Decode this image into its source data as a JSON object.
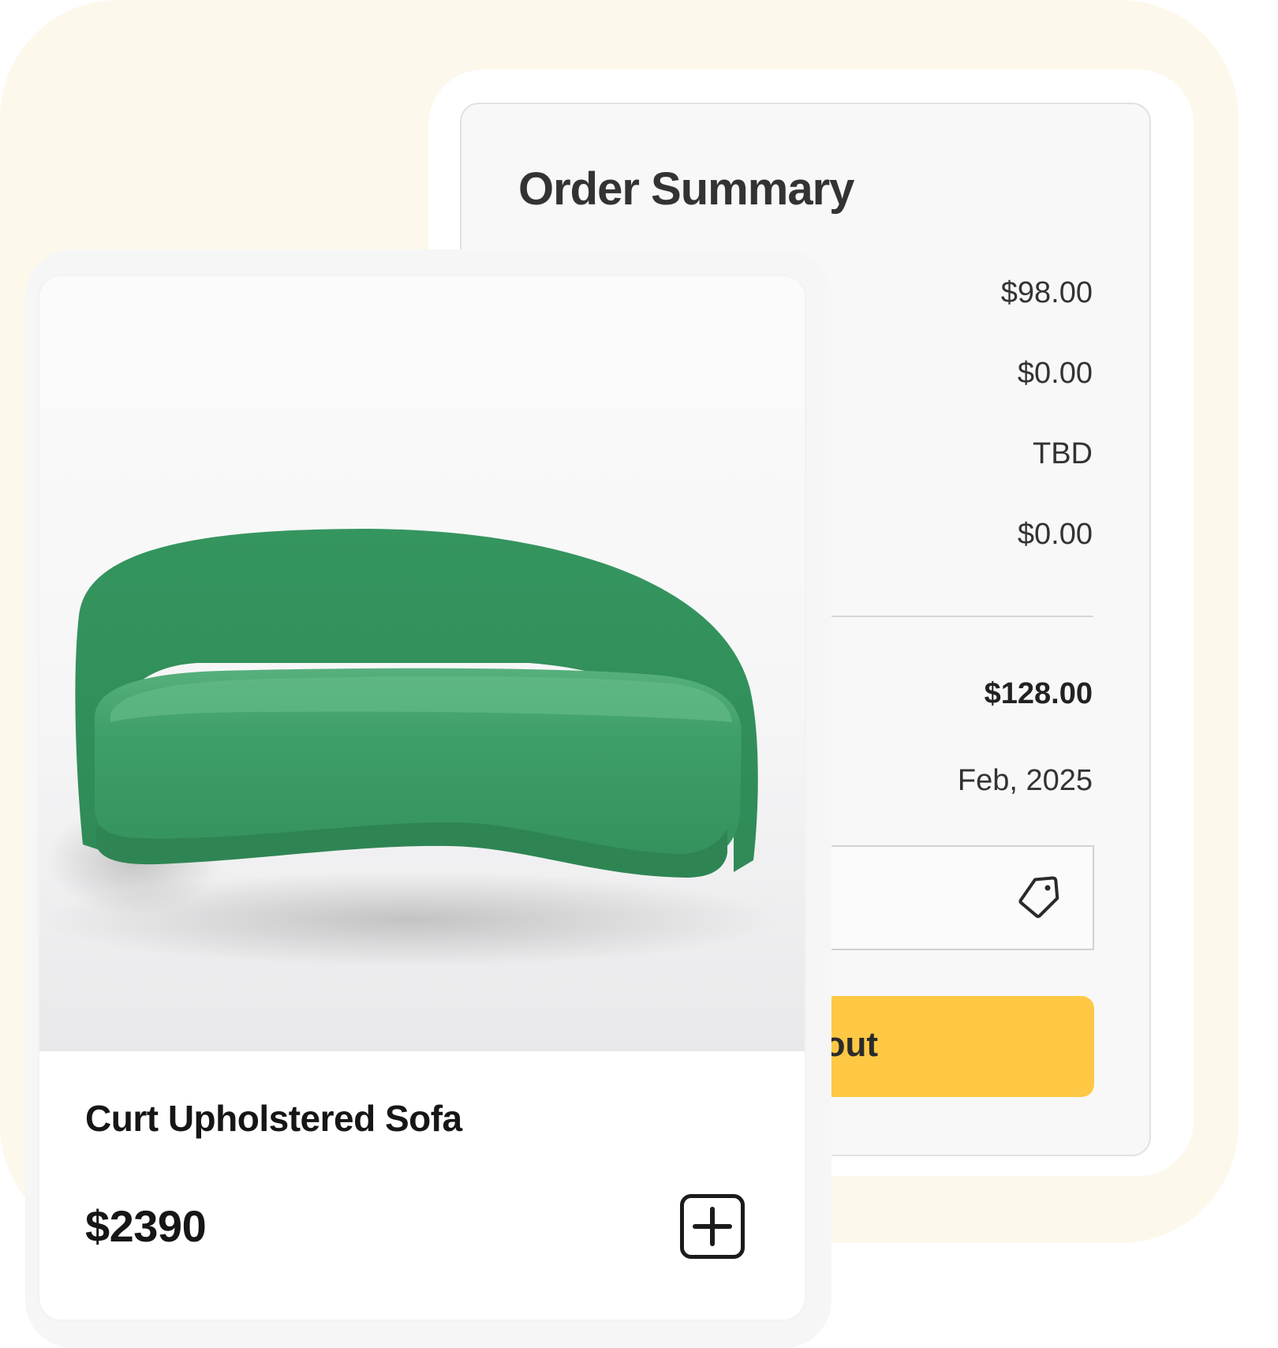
{
  "order_summary": {
    "title": "Order Summary",
    "values": [
      "$98.00",
      "$0.00",
      "TBD",
      "$0.00"
    ],
    "total": "$128.00",
    "delivery_date": "Feb, 2025",
    "checkout_label": "out"
  },
  "product": {
    "name": "Curt Upholstered Sofa",
    "price": "$2390",
    "image_alt": "green sofa"
  },
  "icons": {
    "promo": "tag-icon",
    "add": "plus-square-icon"
  },
  "colors": {
    "backdrop": "#fdf8ec",
    "checkout_button": "#fec844",
    "sofa": "#3a9a64",
    "text_dark": "#161616"
  }
}
